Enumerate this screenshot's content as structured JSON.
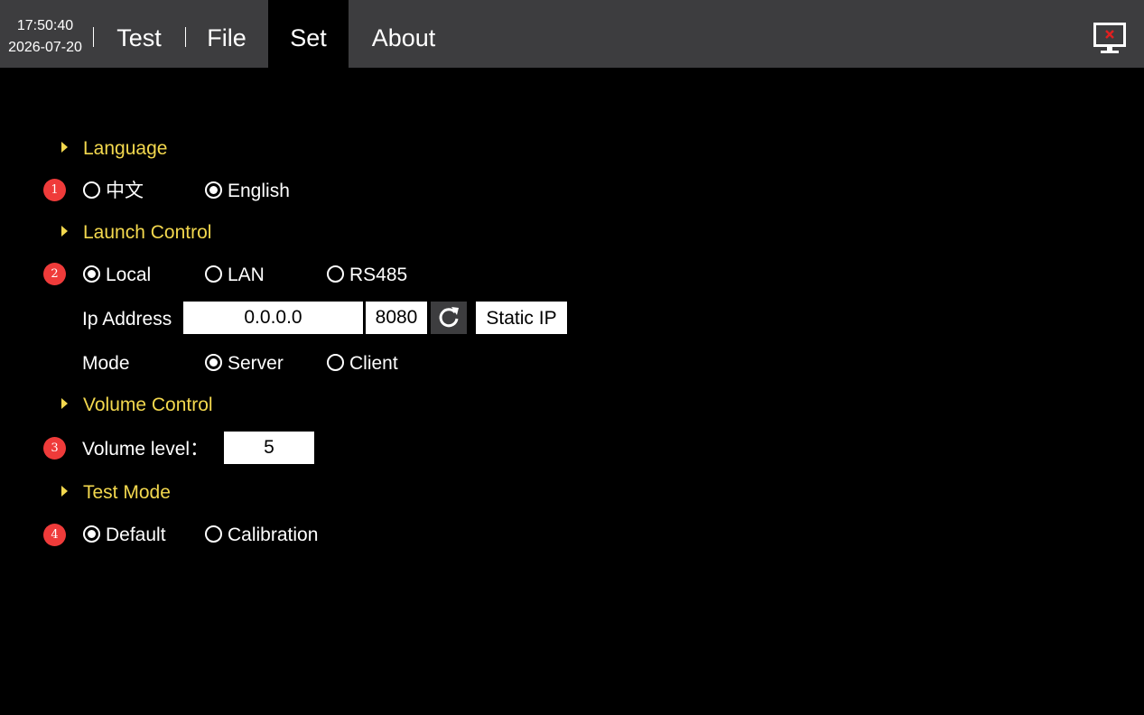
{
  "header": {
    "time": "17:50:40",
    "date": "2026-07-20",
    "tabs": [
      {
        "label": "Test",
        "active": false
      },
      {
        "label": "File",
        "active": false
      },
      {
        "label": "Set",
        "active": true
      },
      {
        "label": "About",
        "active": false
      }
    ],
    "exit_icon": "monitor-close-icon"
  },
  "sections": {
    "language": {
      "title": "Language",
      "badge": "1",
      "options": [
        {
          "label": "中文",
          "selected": false
        },
        {
          "label": "English",
          "selected": true
        }
      ]
    },
    "launch_control": {
      "title": "Launch Control",
      "badge": "2",
      "options": [
        {
          "label": "Local",
          "selected": true
        },
        {
          "label": "LAN",
          "selected": false
        },
        {
          "label": "RS485",
          "selected": false
        }
      ],
      "ip_label": "Ip Address",
      "ip_value": "0.0.0.0",
      "port_value": "8080",
      "refresh_icon": "refresh-icon",
      "static_ip_label": "Static IP",
      "mode_label": "Mode",
      "mode_options": [
        {
          "label": "Server",
          "selected": true
        },
        {
          "label": "Client",
          "selected": false
        }
      ]
    },
    "volume_control": {
      "title": "Volume Control",
      "badge": "3",
      "volume_label": "Volume level：",
      "volume_value": "5"
    },
    "test_mode": {
      "title": "Test Mode",
      "badge": "4",
      "options": [
        {
          "label": "Default",
          "selected": true
        },
        {
          "label": "Calibration",
          "selected": false
        }
      ]
    }
  },
  "colors": {
    "topbar": "#3d3d3f",
    "section_title": "#f3d84e",
    "badge": "#ef3b3a",
    "background": "#000000"
  }
}
